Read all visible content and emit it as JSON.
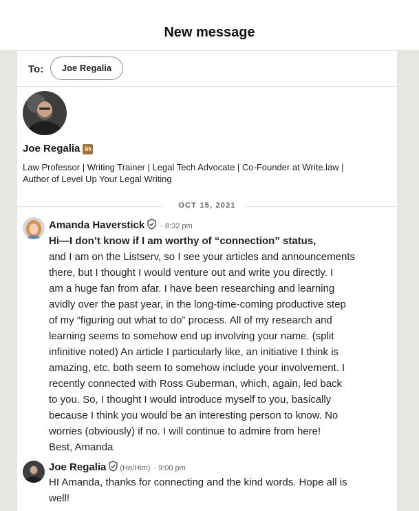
{
  "header": {
    "title": "New message"
  },
  "recipient": {
    "to_label": "To:",
    "name": "Joe Regalia"
  },
  "profile": {
    "name": "Joe Regalia",
    "network_badge": "in",
    "headline_lines": [
      "Law Professor | Writing Trainer | Legal Tech Advocate | Co-Founder at Write.law |",
      "Author of Level Up Your Legal Writing"
    ]
  },
  "thread": {
    "date": "OCT 15, 2021",
    "messages": [
      {
        "sender": "Amanda Haverstick",
        "pronouns": "",
        "time": "8:32 pm",
        "verified_icon": "shield-check-icon",
        "subject": "Hi—I don’t know if I am worthy of “connection” status,",
        "lines": [
          "and I am on the Listserv, so I see your articles and announcements",
          "there, but I thought I would venture out and write you directly.  I",
          "am a huge fan from afar.  I have been researching and learning",
          "avidly over the past year, in the long-time-coming productive step",
          "of my “figuring out what to do” process.  All of my research and",
          "learning seems to somehow end up involving your name.  (split",
          "infinitive noted)  An article I particularly like, an initiative I think is",
          "amazing, etc. both seem to somehow include your involvement.  I",
          "recently connected with Ross Guberman, which, again, led back",
          "to you.  So, I thought I would introduce myself to you, basically",
          "because I think you would be an interesting person to know.  No",
          "worries (obviously) if no.  I will continue to admire from here!",
          "Best, Amanda"
        ]
      },
      {
        "sender": "Joe Regalia",
        "pronouns": "(He/Him)",
        "time": "9:00 pm",
        "verified_icon": "shield-check-icon",
        "lines": [
          "HI Amanda, thanks for connecting and the kind words. Hope all is",
          "well!"
        ]
      }
    ]
  },
  "colors": {
    "background": "#e8e6e3",
    "panel": "#ffffff",
    "linkedin_badge": "#a0733a",
    "meta_text": "#666666"
  }
}
